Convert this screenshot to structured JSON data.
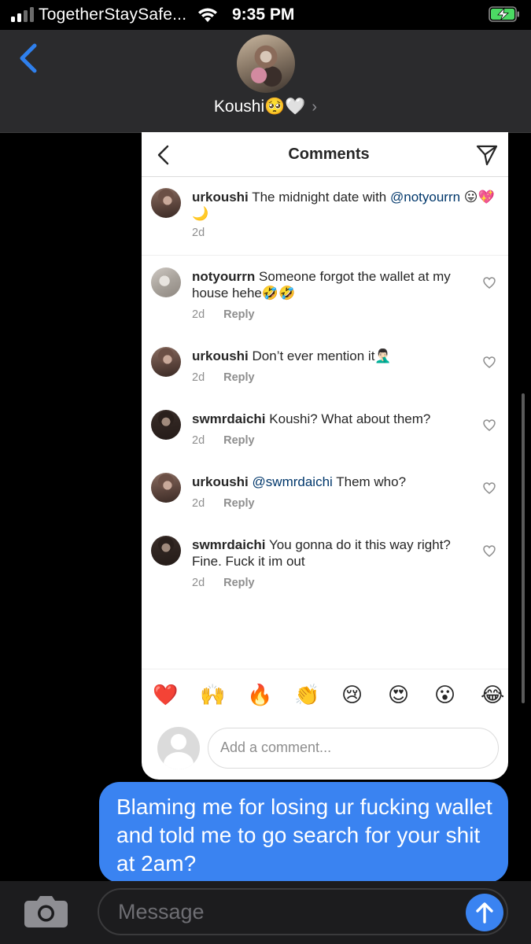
{
  "status": {
    "carrier": "TogetherStaySafe...",
    "time": "9:35 PM",
    "signal_bars": 4,
    "signal_active": 2
  },
  "header": {
    "contact_name": "Koushi🥺🤍",
    "chevron": "›"
  },
  "instagram": {
    "title": "Comments",
    "caption": {
      "user": "urkoushi",
      "text_before": " The midnight date with ",
      "mention": "@notyourrn",
      "text_after": " 😛💖🌙",
      "time": "2d"
    },
    "comments": [
      {
        "user": "notyourrn",
        "text": " Someone forgot the wallet at my house hehe🤣🤣",
        "time": "2d",
        "reply": "Reply",
        "avatar": "notyourrn-avatar"
      },
      {
        "user": "urkoushi",
        "text": " Don’t ever mention it🤦🏻‍♂️",
        "time": "2d",
        "reply": "Reply",
        "avatar": "urkoushi-avatar"
      },
      {
        "user": "swmrdaichi",
        "text": " Koushi? What about them?",
        "time": "2d",
        "reply": "Reply",
        "avatar": "swmrdaichi-avatar"
      },
      {
        "user": "urkoushi",
        "mention": "@swmrdaichi",
        "text": " Them who?",
        "time": "2d",
        "reply": "Reply",
        "avatar": "urkoushi-avatar"
      },
      {
        "user": "swmrdaichi",
        "text": " You gonna do it this way right? Fine. Fuck it im out",
        "time": "2d",
        "reply": "Reply",
        "avatar": "swmrdaichi-avatar"
      }
    ],
    "emoji_reactions": [
      "❤️",
      "🙌",
      "🔥",
      "👏",
      "😢",
      "😍",
      "😮",
      "😂"
    ],
    "add_comment_placeholder": "Add a comment..."
  },
  "message": {
    "text": "Blaming me for losing ur fucking wallet and told me to go search for your shit at 2am?"
  },
  "input": {
    "placeholder": "Message"
  },
  "colors": {
    "imessage_blue": "#3a83f1",
    "ios_back_blue": "#2f80ed",
    "header_bg": "#2b2b2d",
    "ig_mention": "#00376b"
  }
}
